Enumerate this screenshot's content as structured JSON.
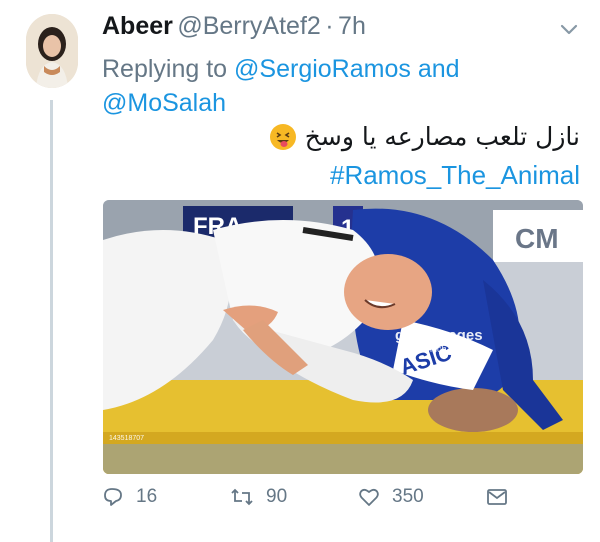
{
  "tweet": {
    "display_name": "Abeer",
    "handle": "@BerryAtef2",
    "separator": "·",
    "time": "7h",
    "replying_prefix": "Replying to",
    "replying_user_1": "@SergioRamos",
    "replying_and": "and",
    "replying_user_2": "@MoSalah",
    "text_arabic": "نازل تلعب مصارعه يا وسخ",
    "emoji": "face-with-tongue-emoji",
    "hashtag": "#Ramos_The_Animal"
  },
  "media": {
    "description_icon": "judo-photo",
    "scoreboard_text": "FRA",
    "scoreboard_number": "1",
    "sponsor_text": "CM",
    "watermark_brand": "gettyimages",
    "watermark_credit": "David Finch",
    "image_id": "143518707"
  },
  "actions": {
    "reply_count": "16",
    "retweet_count": "90",
    "like_count": "350"
  },
  "colors": {
    "link": "#1b95e0",
    "secondary_text": "#657786",
    "thread_line": "#ccd6dd"
  }
}
